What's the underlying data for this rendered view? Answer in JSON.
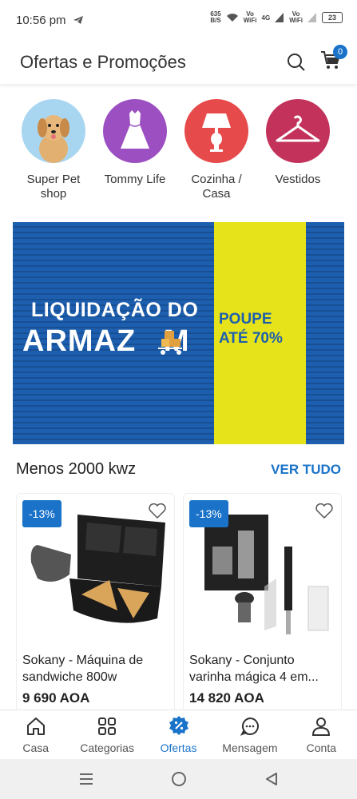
{
  "status": {
    "time": "10:56 pm",
    "speed_value": "635",
    "speed_unit": "B/S",
    "vo1": "Vo",
    "wifi1": "WiFi",
    "net": "4G",
    "vo2": "Vo",
    "wifi2": "WiFi",
    "battery": "23"
  },
  "header": {
    "title": "Ofertas e Promoções",
    "cart_count": "0"
  },
  "categories": [
    {
      "label": "Super Pet shop",
      "color": "#a8d6f0",
      "icon": "dog-icon"
    },
    {
      "label": "Tommy Life",
      "color": "#9b4fc1",
      "icon": "dress-icon"
    },
    {
      "label": "Cozinha / Casa",
      "color": "#e64a4a",
      "icon": "lamp-icon"
    },
    {
      "label": "Vestidos",
      "color": "#c2325a",
      "icon": "hanger-icon"
    }
  ],
  "banner": {
    "line1": "LIQUIDAÇÃO DO",
    "line2": "ARMAZ   M",
    "line3a": "POUPE",
    "line3b": "ATÉ 70%"
  },
  "section": {
    "title": "Menos 2000 kwz",
    "link": "VER TUDO"
  },
  "products": [
    {
      "discount": "-13%",
      "name": "Sokany - Máquina de sandwiche 800w",
      "price": "9 690 AOA"
    },
    {
      "discount": "-13%",
      "name": "Sokany - Conjunto varinha mágica 4 em...",
      "price": "14 820 AOA"
    }
  ],
  "nav": [
    {
      "label": "Casa"
    },
    {
      "label": "Categorias"
    },
    {
      "label": "Ofertas"
    },
    {
      "label": "Mensagem"
    },
    {
      "label": "Conta"
    }
  ],
  "colors": {
    "accent": "#1a73c9",
    "banner_blue": "#1d5fae",
    "banner_yellow": "#e6e31a"
  }
}
